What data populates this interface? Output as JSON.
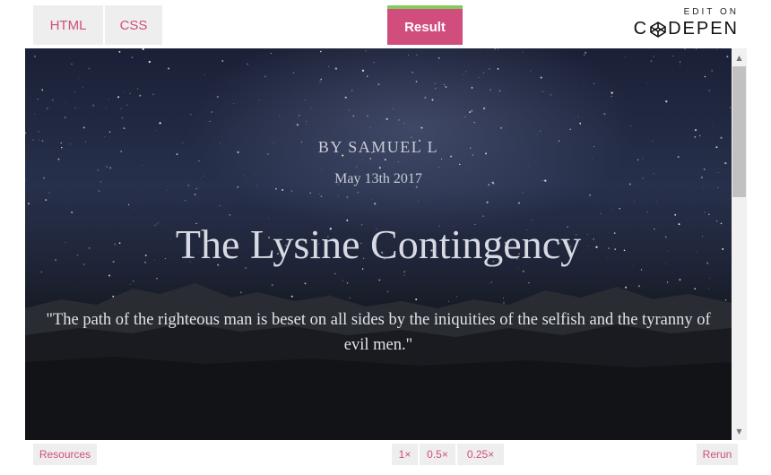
{
  "toolbar": {
    "tabs": [
      "HTML",
      "CSS"
    ],
    "result_tab": "Result",
    "edit_on": "EDIT ON",
    "codepen_word_left": "C",
    "codepen_word_right": "DEPEN"
  },
  "preview": {
    "byline": "BY SAMUEL L",
    "date": "May 13th 2017",
    "title": "The Lysine Contingency",
    "quote": "\"The path of the righteous man is beset on all sides by the iniquities of the selfish and the tyranny of evil men.\""
  },
  "scrollbar": {
    "up_glyph": "▲",
    "down_glyph": "▼"
  },
  "bottom": {
    "resources_label": "Resources",
    "zoom_options": [
      "1×",
      "0.5×",
      "0.25×"
    ],
    "rerun_label": "Rerun"
  },
  "colors": {
    "accent": "#d04d7e",
    "result_top_border": "#84c95d",
    "tab_bg": "#eeeeee"
  }
}
